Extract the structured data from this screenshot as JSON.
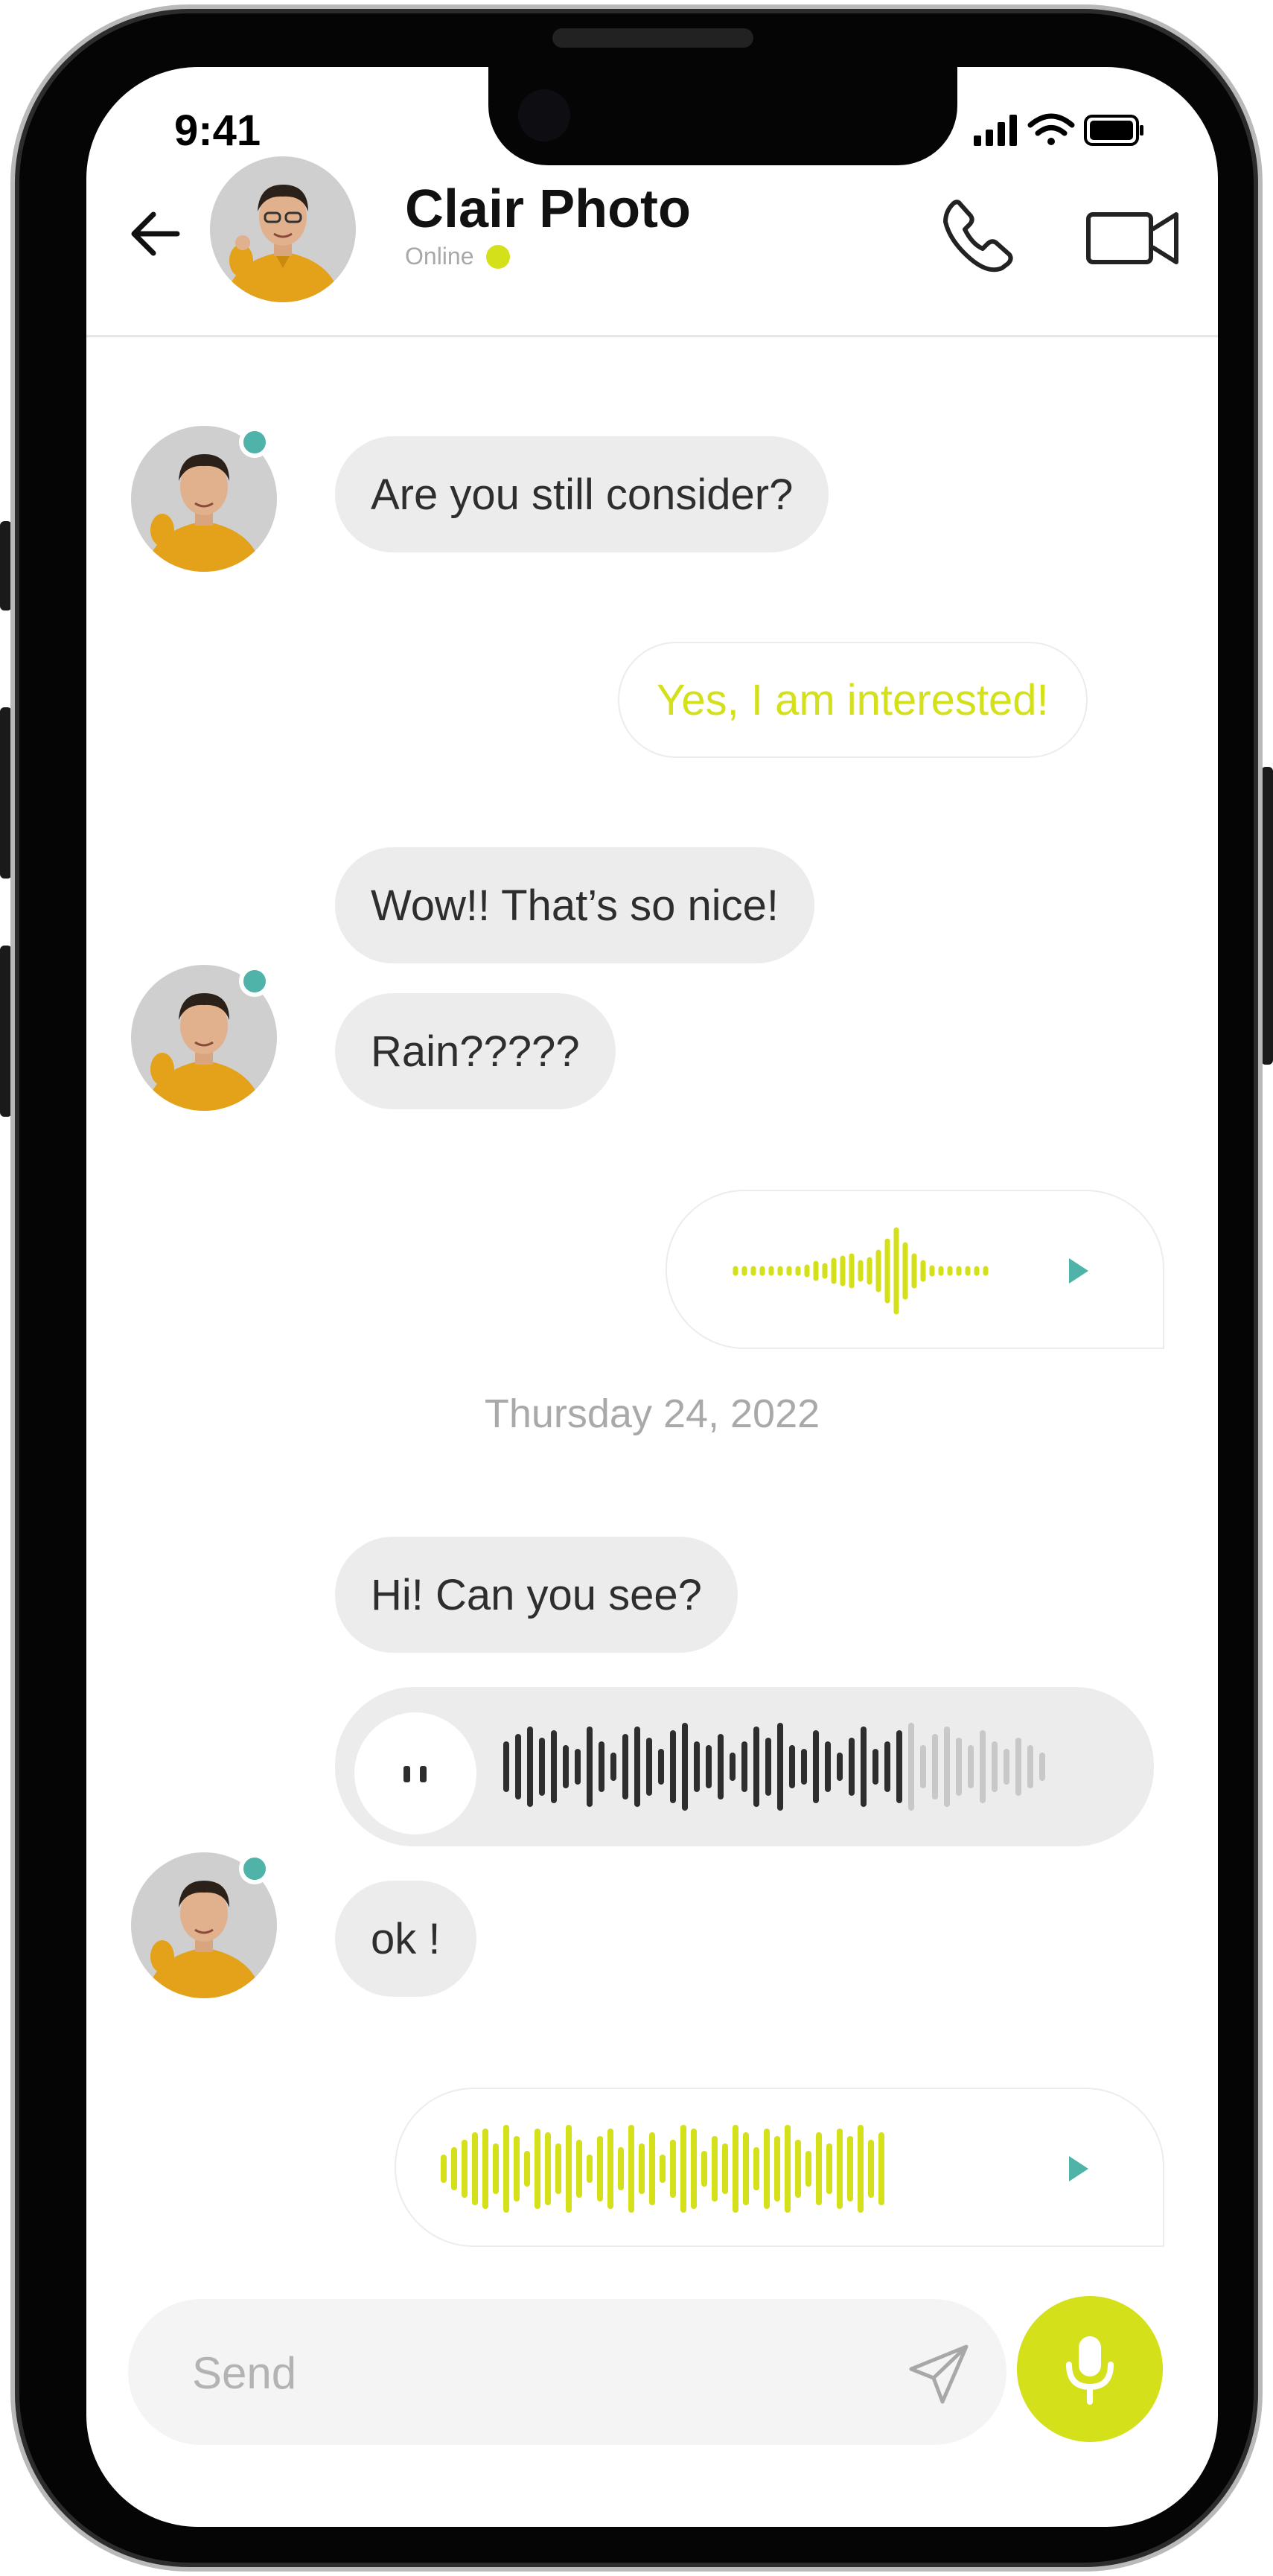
{
  "colors": {
    "accent": "#d4e019",
    "teal": "#4fb3a9",
    "incoming_bubble": "#ececec",
    "waveform_dark": "#2e2e2e",
    "waveform_light": "#c8c8c8"
  },
  "status_bar": {
    "time": "9:41",
    "icons": [
      "signal-icon",
      "wifi-icon",
      "battery-icon"
    ]
  },
  "header": {
    "contact_name": "Clair Photo",
    "status": "Online",
    "icons": [
      "back-arrow-icon",
      "phone-icon",
      "video-icon"
    ]
  },
  "messages": {
    "m1": "Are you still consider?",
    "m2": "Yes, I am interested!",
    "m3": "Wow!! That’s so nice!",
    "m4": "Rain?????",
    "m5_voice": "outgoing-voice-message",
    "date_separator": "Thursday 24, 2022",
    "m6": "Hi! Can you see?",
    "m7_voice": "incoming-voice-message",
    "m7_progress": 0.73,
    "m8": "ok !",
    "m9_voice": "outgoing-voice-message"
  },
  "composer": {
    "placeholder": "Send",
    "icons": [
      "send-icon",
      "microphone-icon"
    ]
  }
}
